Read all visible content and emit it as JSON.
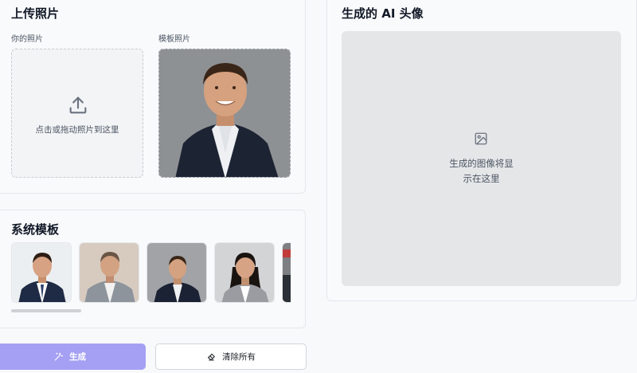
{
  "upload": {
    "title": "上传照片",
    "your_photo_label": "你的照片",
    "template_photo_label": "模板照片",
    "dropzone_hint": "点击或拖动照片到这里"
  },
  "templates": {
    "title": "系统模板",
    "items": [
      {
        "icon": "portrait-young-man-navy-suit"
      },
      {
        "icon": "portrait-man-grey-suit"
      },
      {
        "icon": "portrait-man-dark-suit"
      },
      {
        "icon": "portrait-woman-grey-blazer"
      },
      {
        "icon": "portrait-partial"
      }
    ]
  },
  "result": {
    "title": "生成的 AI 头像",
    "placeholder_line1": "生成的图像将显",
    "placeholder_line2": "示在这里"
  },
  "actions": {
    "generate_label": "生成",
    "clear_label": "清除所有"
  },
  "colors": {
    "accent": "#a5a0f3",
    "background": "#f8f9fb",
    "card": "#f9fafb",
    "preview": "#e5e6e8"
  }
}
